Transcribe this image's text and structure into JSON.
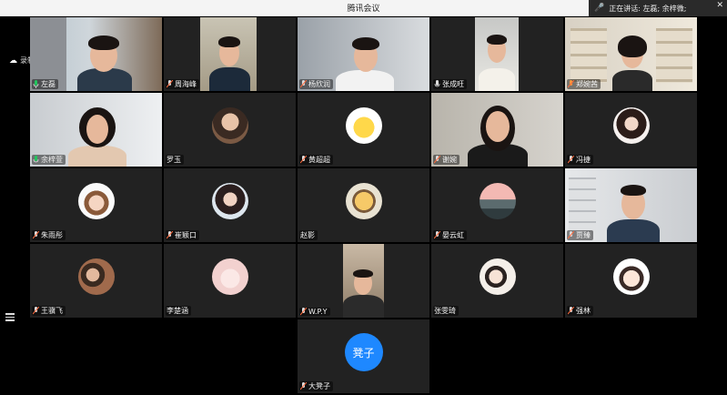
{
  "window": {
    "title": "腾讯会议"
  },
  "speaking_indicator": {
    "text": "正在讲话: 左磊; 余梓微;"
  },
  "recording": {
    "text": "录制中"
  },
  "participants": [
    {
      "name": "左磊",
      "type": "video",
      "mic": "active",
      "active_speaker": true
    },
    {
      "name": "周海峰",
      "type": "video",
      "mic": "muted"
    },
    {
      "name": "杨欣润",
      "type": "video",
      "mic": "muted"
    },
    {
      "name": "张成旺",
      "type": "video",
      "mic": "on"
    },
    {
      "name": "郑婉茜",
      "type": "video",
      "mic": "muted"
    },
    {
      "name": "余梓萱",
      "type": "video",
      "mic": "active"
    },
    {
      "name": "罗玉",
      "type": "avatar",
      "mic": "none"
    },
    {
      "name": "黄超超",
      "type": "avatar",
      "mic": "muted"
    },
    {
      "name": "谢婉",
      "type": "video",
      "mic": "muted"
    },
    {
      "name": "冯捷",
      "type": "avatar",
      "mic": "muted"
    },
    {
      "name": "朱雨彤",
      "type": "avatar",
      "mic": "muted"
    },
    {
      "name": "崔颖口",
      "type": "avatar",
      "mic": "muted"
    },
    {
      "name": "赵影",
      "type": "avatar",
      "mic": "none"
    },
    {
      "name": "晏云虹",
      "type": "avatar",
      "mic": "muted"
    },
    {
      "name": "贾臻",
      "type": "video",
      "mic": "muted"
    },
    {
      "name": "王骥飞",
      "type": "avatar",
      "mic": "muted"
    },
    {
      "name": "李楚涵",
      "type": "avatar",
      "mic": "none"
    },
    {
      "name": "W.P.Y",
      "type": "video",
      "mic": "muted"
    },
    {
      "name": "张雯琦",
      "type": "avatar",
      "mic": "none"
    },
    {
      "name": "强林",
      "type": "avatar",
      "mic": "muted"
    },
    {
      "name": "大凳子",
      "type": "text-avatar",
      "avatar_text": "凳子",
      "mic": "muted"
    }
  ],
  "colors": {
    "tile_bg": "#222222",
    "active_border": "#18c77d",
    "mic_active": "#22c55e",
    "mic_muted": "#ff6a3d",
    "text_avatar_bg": "#1e88ff"
  }
}
